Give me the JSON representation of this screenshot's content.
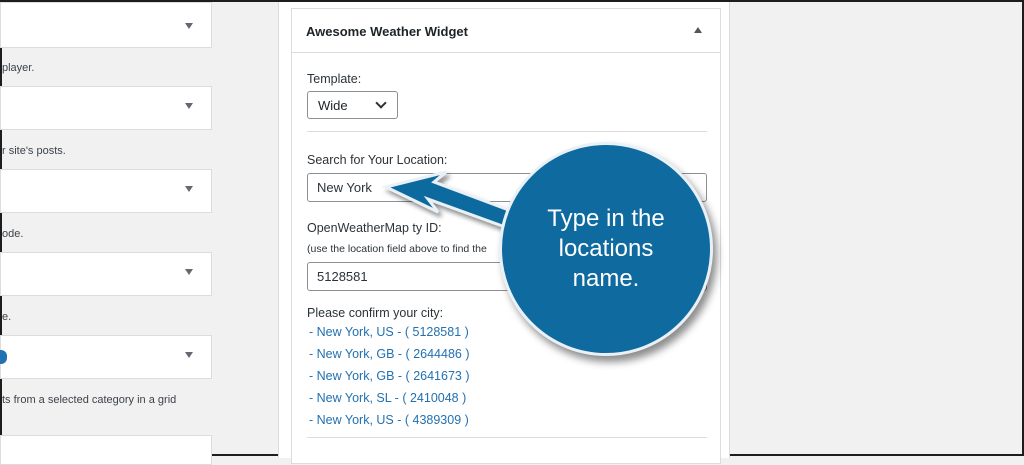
{
  "left_column": {
    "descriptions": [
      "player.",
      "r site's posts.",
      "ode.",
      "e.",
      "ts from a selected category in a grid"
    ]
  },
  "widget": {
    "title": "Awesome Weather Widget",
    "template_label": "Template:",
    "template_value": "Wide",
    "search_label": "Search for Your Location:",
    "search_value": "New York",
    "owm_label": "OpenWeatherMap",
    "owm_label_tail": "ty ID:",
    "owm_help": "(use the location field above to find the",
    "owm_value": "5128581",
    "confirm_label": "Please confirm your city:",
    "cities": [
      "- New York, US - ( 5128581 )",
      "- New York, GB - ( 2644486 )",
      "- New York, GB - ( 2641673 )",
      "- New York, SL - ( 2410048 )",
      "- New York, US - ( 4389309 )"
    ]
  },
  "callout": {
    "text_line1": "Type in the",
    "text_line2": "locations name.",
    "color": "#0e6a9f"
  }
}
